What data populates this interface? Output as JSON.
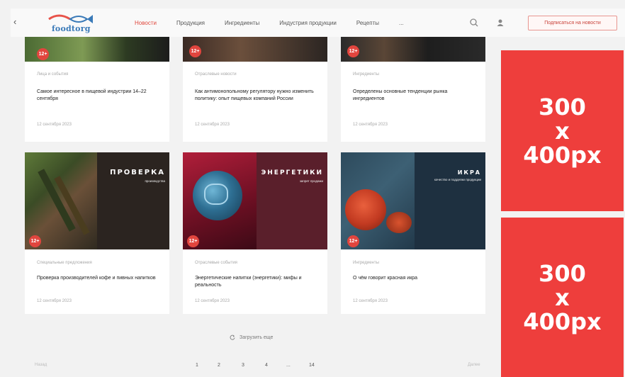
{
  "header": {
    "logo_text": "foodtorg",
    "nav": [
      "Новости",
      "Продукция",
      "Ингредиенты",
      "Индустрия продукции",
      "Рецепты",
      "..."
    ],
    "active_nav": 0,
    "subscribe_label": "Подписаться на новости"
  },
  "cards_top": [
    {
      "badge": "12+",
      "category": "Лица и события",
      "title": "Самое интересное в пищевой индустрии 14–22 сентября",
      "date": "12 сентября 2023"
    },
    {
      "badge": "12+",
      "category": "Отраслевые новости",
      "title": "Как антимонопольному регулятору нужно изменить политику: опыт пищевых компаний России",
      "date": "12 сентября 2023"
    },
    {
      "badge": "12+",
      "category": "Ингредиенты",
      "title": "Определены основные тенденции рынка ингредиентов",
      "date": "12 сентября 2023"
    }
  ],
  "cards_bottom": [
    {
      "badge": "12+",
      "image_heading": "ПРОВЕРКА",
      "image_sub": "производства",
      "category": "Специальные предложения",
      "title": "Проверка производителей кофе и пивных напитков",
      "date": "12 сентября 2023"
    },
    {
      "badge": "12+",
      "image_heading": "ЭНЕРГЕТИКИ",
      "image_sub": "запрет продажи",
      "category": "Отраслевые события",
      "title": "Энергетические напитки (энергетики): мифы и реальность",
      "date": "12 сентября 2023"
    },
    {
      "badge": "12+",
      "image_heading": "ИКРА",
      "image_sub": "качество и подделки продукции",
      "category": "Ингредиенты",
      "title": "О чём говорит красная икра",
      "date": "12 сентября 2023"
    }
  ],
  "ads": [
    {
      "line1": "300",
      "line2": "x",
      "line3": "400px"
    },
    {
      "line1": "300",
      "line2": "x",
      "line3": "400px"
    }
  ],
  "show_more": "Загрузить еще",
  "pagination": {
    "prev": "Назад",
    "pages": [
      "1",
      "2",
      "3",
      "4",
      "...",
      "14"
    ],
    "next": "Далее"
  },
  "colors": {
    "accent": "#ee3e3c",
    "badge": "#e1453e",
    "background": "#f2f2f2"
  }
}
